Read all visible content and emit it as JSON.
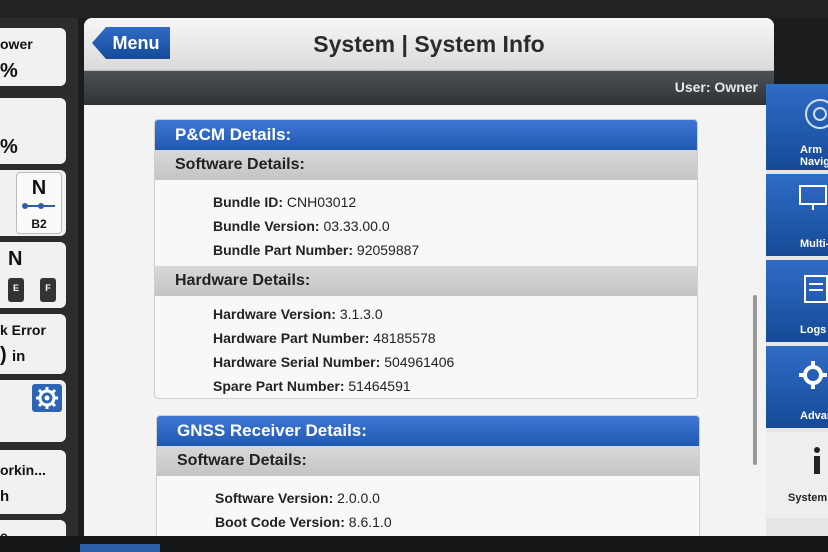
{
  "window": {
    "title": "System | System Info",
    "menu_label": "Menu",
    "user": "User: Owner"
  },
  "left_panel": {
    "w1": "ower",
    "w1b": "%",
    "w2": "%",
    "w3_top": "N",
    "w3_bottom": "B2",
    "w4_top": "N",
    "w4_e": "E",
    "w4_f": "F",
    "w5_a": "k Error",
    "w5_b": ")",
    "w5_c": "in",
    "w7_a": "orkin...",
    "w7_b": "h",
    "w8": "e"
  },
  "sections": [
    {
      "title": "P&CM Details:",
      "groups": [
        {
          "title": "Software Details:",
          "rows": [
            {
              "label": "Bundle ID:",
              "value": "CNH03012"
            },
            {
              "label": "Bundle Version:",
              "value": "03.33.00.0"
            },
            {
              "label": "Bundle Part Number:",
              "value": "92059887"
            }
          ]
        },
        {
          "title": "Hardware Details:",
          "rows": [
            {
              "label": "Hardware Version:",
              "value": "3.1.3.0"
            },
            {
              "label": "Hardware Part Number:",
              "value": "48185578"
            },
            {
              "label": "Hardware Serial Number:",
              "value": "504961406"
            },
            {
              "label": "Spare Part Number:",
              "value": "51464591"
            }
          ]
        }
      ]
    },
    {
      "title": "GNSS Receiver Details:",
      "groups": [
        {
          "title": "Software Details:",
          "rows": [
            {
              "label": "Software Version:",
              "value": "2.0.0.0"
            },
            {
              "label": "Boot Code Version:",
              "value": "8.6.1.0"
            }
          ]
        }
      ]
    }
  ],
  "right_nav": [
    {
      "label": "Arm",
      "label2": "Navig",
      "icon": "target-icon"
    },
    {
      "label": "Multi-D",
      "icon": "monitor-icon"
    },
    {
      "label": "Logs F",
      "icon": "log-icon"
    },
    {
      "label": "Advanc",
      "icon": "gear-icon"
    },
    {
      "label": "System I",
      "icon": "info-icon"
    }
  ],
  "colors": {
    "accent": "#2b63bd",
    "header": "#2158b3",
    "subheader": "#c8c8c8"
  }
}
